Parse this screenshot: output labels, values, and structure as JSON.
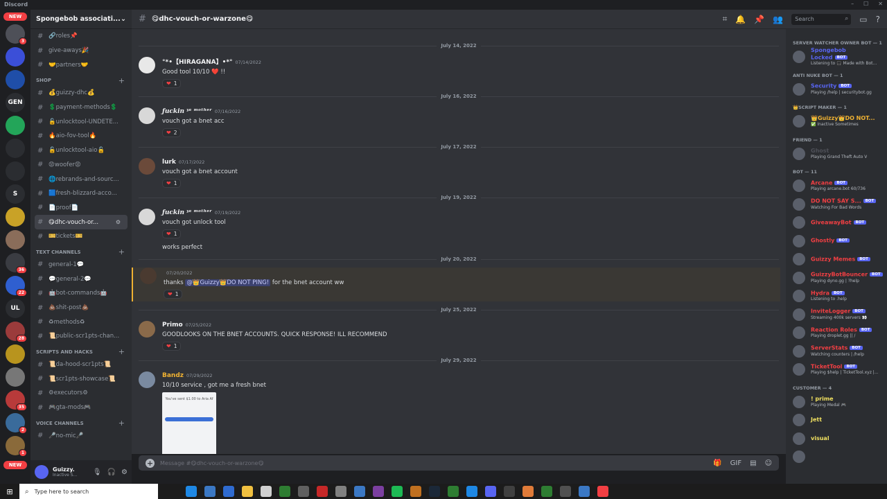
{
  "window": {
    "app_name": "Discord",
    "min": "–",
    "max": "☐",
    "close": "✕"
  },
  "servers": {
    "new_label": "NEW",
    "items": [
      {
        "label": "",
        "color": "#4e5058",
        "badge": "3"
      },
      {
        "label": "",
        "color": "#3b4fd8",
        "badge": ""
      },
      {
        "label": "",
        "color": "#1f4ea8",
        "badge": ""
      },
      {
        "label": "GEN",
        "color": "#2b2d31",
        "badge": ""
      },
      {
        "label": "",
        "color": "#23a559",
        "badge": ""
      },
      {
        "label": "",
        "color": "#2b2d31",
        "badge": ""
      },
      {
        "label": "",
        "color": "#2b2d31",
        "badge": ""
      },
      {
        "label": "S",
        "color": "#2b2d31",
        "badge": ""
      },
      {
        "label": "",
        "color": "#c9a227",
        "badge": ""
      },
      {
        "label": "",
        "color": "#8a6d5a",
        "badge": ""
      },
      {
        "label": "",
        "color": "#3a3c42",
        "badge": "36"
      },
      {
        "label": "",
        "color": "#2f5fd0",
        "badge": "22"
      },
      {
        "label": "UL",
        "color": "#2b2d31",
        "badge": ""
      },
      {
        "label": "",
        "color": "#9b3b3b",
        "badge": "28"
      },
      {
        "label": "",
        "color": "#b8941e",
        "badge": ""
      },
      {
        "label": "",
        "color": "#777777",
        "badge": ""
      },
      {
        "label": "",
        "color": "#b83a3a",
        "badge": "35"
      },
      {
        "label": "",
        "color": "#3a6b9b",
        "badge": "2"
      },
      {
        "label": "",
        "color": "#8a6a3a",
        "badge": "1"
      }
    ],
    "new_bottom": "NEW"
  },
  "guild": {
    "name": "Spongebob associati..."
  },
  "channels": {
    "top": [
      {
        "name": "🔗roles📌"
      },
      {
        "name": "give-aways🎉"
      },
      {
        "name": "🤝partners🤝"
      }
    ],
    "shop_label": "SHOP",
    "shop": [
      {
        "name": "💰guizzy-dhc💰"
      },
      {
        "name": "💲payment-methods💲"
      },
      {
        "name": "🔓unlocktool-UNDETE..."
      },
      {
        "name": "🔥aio-fov-tool🔥"
      },
      {
        "name": "🔓unlocktool-aio🔓"
      },
      {
        "name": "😡woofer😡"
      },
      {
        "name": "🌐rebrands-and-sourc..."
      },
      {
        "name": "🟦fresh-blizzard-acco..."
      },
      {
        "name": "📄proof📄"
      },
      {
        "name": "😋dhc-vouch-or..."
      },
      {
        "name": "🎫tickets🎫"
      }
    ],
    "text_label": "TEXT CHANNELS",
    "text": [
      {
        "name": "general-1💬"
      },
      {
        "name": "💬general-2💬"
      },
      {
        "name": "🤖bot-commands🤖"
      },
      {
        "name": "💩shit-post💩"
      },
      {
        "name": "♻methods♻"
      },
      {
        "name": "📜public-scr1pts-chan..."
      }
    ],
    "scripts_label": "SCRIPTS AND HACKS",
    "scripts": [
      {
        "name": "📜da-hood-scr1pts📜"
      },
      {
        "name": "📜scr1pts-showcase📜"
      },
      {
        "name": "⚙executors⚙"
      },
      {
        "name": "🎮gta-mods🎮"
      }
    ],
    "voice_label": "VOICE CHANNELS",
    "voice": [
      {
        "name": "🎤no-mic🎤"
      }
    ]
  },
  "user": {
    "name": "Guizzy.",
    "status": "Inactive S..."
  },
  "header": {
    "channel": "😋dhc-vouch-or-warzone😋",
    "search_placeholder": "Search"
  },
  "messages": [
    {
      "date": "July 14, 2022",
      "user": "°*•【HIRAGANA】•*°",
      "ts": "07/14/2022",
      "text": "Good tool 10/10 ❤️ !!",
      "reaction": "1",
      "avatar": "#e8e8e8"
    },
    {
      "date": "July 16, 2022",
      "user": "ƒuckin ʸᵃ ᵐᵒᵗʰᵉʳ",
      "ts": "07/16/2022",
      "text": "vouch got a bnet acc",
      "reaction": "2",
      "avatar": "#d8d8d8"
    },
    {
      "date": "July 17, 2022",
      "user": "lurk",
      "ts": "07/17/2022",
      "text": "vouch got a bnet account",
      "reaction": "1",
      "avatar": "#6b4a3a"
    },
    {
      "date": "July 19, 2022",
      "user": "ƒuckin ʸᵃ ᵐᵒᵗʰᵉʳ",
      "ts": "07/19/2022",
      "text": "vouch got unlock tool",
      "reaction": "1",
      "text2": "works perfect",
      "avatar": "#d8d8d8"
    },
    {
      "date": "July 20, 2022",
      "user": "",
      "ts": "07/20/2022",
      "text_pre": "thanks ",
      "mention": "@👑Guizzy👑DO NOT PING!",
      "text_post": " for the bnet account ww",
      "reaction": "1",
      "avatar": "#4a3a30"
    },
    {
      "date": "July 25, 2022",
      "user": "Primo",
      "ts": "07/25/2022",
      "text": "GOODLOOKS ON THE BNET ACCOUNTS. QUICK RESPONSE! ILL RECOMMEND",
      "reaction": "1",
      "avatar": "#8a6a4a"
    },
    {
      "date": "July 29, 2022",
      "user": "Bandz",
      "ts": "07/29/2022",
      "text": "10/10 service , got me a fresh bnet",
      "attach_text": "You've sent $1.00 to Aria Af",
      "avatar": "#7a8aa0"
    }
  ],
  "composer": {
    "placeholder": "Message #😋dhc-vouch-or-warzone😋"
  },
  "members": {
    "groups": [
      {
        "label": "SERVER WATCHER OWNER BOT — 1",
        "items": [
          {
            "name": "Spongebob Locked",
            "status": "Listening to 🎧 Made with Bot...",
            "bot": "BOT",
            "color": "#5865f2"
          }
        ]
      },
      {
        "label": "ANTI NUKE BOT — 1",
        "items": [
          {
            "name": "Security",
            "status": "Playing /help | securitybot.gg",
            "bot": "BOT",
            "color": "#5865f2"
          }
        ]
      },
      {
        "label": "👑SCRIPT MAKER — 1",
        "items": [
          {
            "name": "👑Guizzy👑DO NOT...",
            "status": "✅ Inactive Sometimes",
            "bot": "",
            "color": "#f0b232"
          }
        ]
      },
      {
        "label": "FRIEND — 1",
        "items": [
          {
            "name": "Ghost",
            "status": "Playing Grand Theft Auto V",
            "bot": "",
            "color": "#4e5058"
          }
        ]
      },
      {
        "label": "BOT — 11",
        "items": [
          {
            "name": "Arcane",
            "status": "Playing arcane.bot 60/736",
            "bot": "BOT",
            "color": "#f23f43"
          },
          {
            "name": "DO NOT SAY S...",
            "status": "Watching For Bad Words",
            "bot": "BOT",
            "color": "#f23f43"
          },
          {
            "name": "GiveawayBot",
            "status": "",
            "bot": "BOT",
            "color": "#f23f43"
          },
          {
            "name": "Ghostly",
            "status": "",
            "bot": "BOT",
            "color": "#f23f43"
          },
          {
            "name": "Guizzy Memes",
            "status": "",
            "bot": "BOT",
            "color": "#f23f43"
          },
          {
            "name": "GuizzyBotBouncer",
            "status": "Playing dyno.gg | ?help",
            "bot": "BOT",
            "color": "#f23f43"
          },
          {
            "name": "Hydra",
            "status": "Listening to .help",
            "bot": "BOT",
            "color": "#f23f43"
          },
          {
            "name": "InviteLogger",
            "status": "Streaming 400k servers 👀",
            "bot": "BOT",
            "color": "#f23f43"
          },
          {
            "name": "Reaction Roles",
            "status": "Playing droplet.gg || /",
            "bot": "BOT",
            "color": "#f23f43"
          },
          {
            "name": "ServerStats",
            "status": "Watching counters | /help",
            "bot": "BOT",
            "color": "#f23f43"
          },
          {
            "name": "TicketTool",
            "status": "Playing $help | TicketTool.xyz |...",
            "bot": "BOT",
            "color": "#f23f43"
          }
        ]
      },
      {
        "label": "CUSTOMER — 4",
        "items": [
          {
            "name": "! prime",
            "status": "Playing Medal 🎮",
            "bot": "",
            "color": "#f0e060"
          },
          {
            "name": "Jett",
            "status": "",
            "bot": "",
            "color": "#f0e060"
          },
          {
            "name": "visual",
            "status": "",
            "bot": "",
            "color": "#f0e060"
          },
          {
            "name": "",
            "status": "",
            "bot": "",
            "color": "#f0e060"
          }
        ]
      }
    ]
  },
  "taskbar": {
    "search_placeholder": "Type here to search",
    "apps": [
      "#1e88e5",
      "#3b78c4",
      "#2f6bd0",
      "#f0c040",
      "#d0d0d0",
      "#2e7d32",
      "#606060",
      "#c62828",
      "#808080",
      "#3b78c4",
      "#7b3fa0",
      "#1db954",
      "#c07020",
      "#1b2838",
      "#2e7d32",
      "#1e88e5",
      "#5865f2",
      "#404040",
      "#e07b39",
      "#2e7d32",
      "#505050",
      "#3b78c4",
      "#f23f43"
    ]
  }
}
